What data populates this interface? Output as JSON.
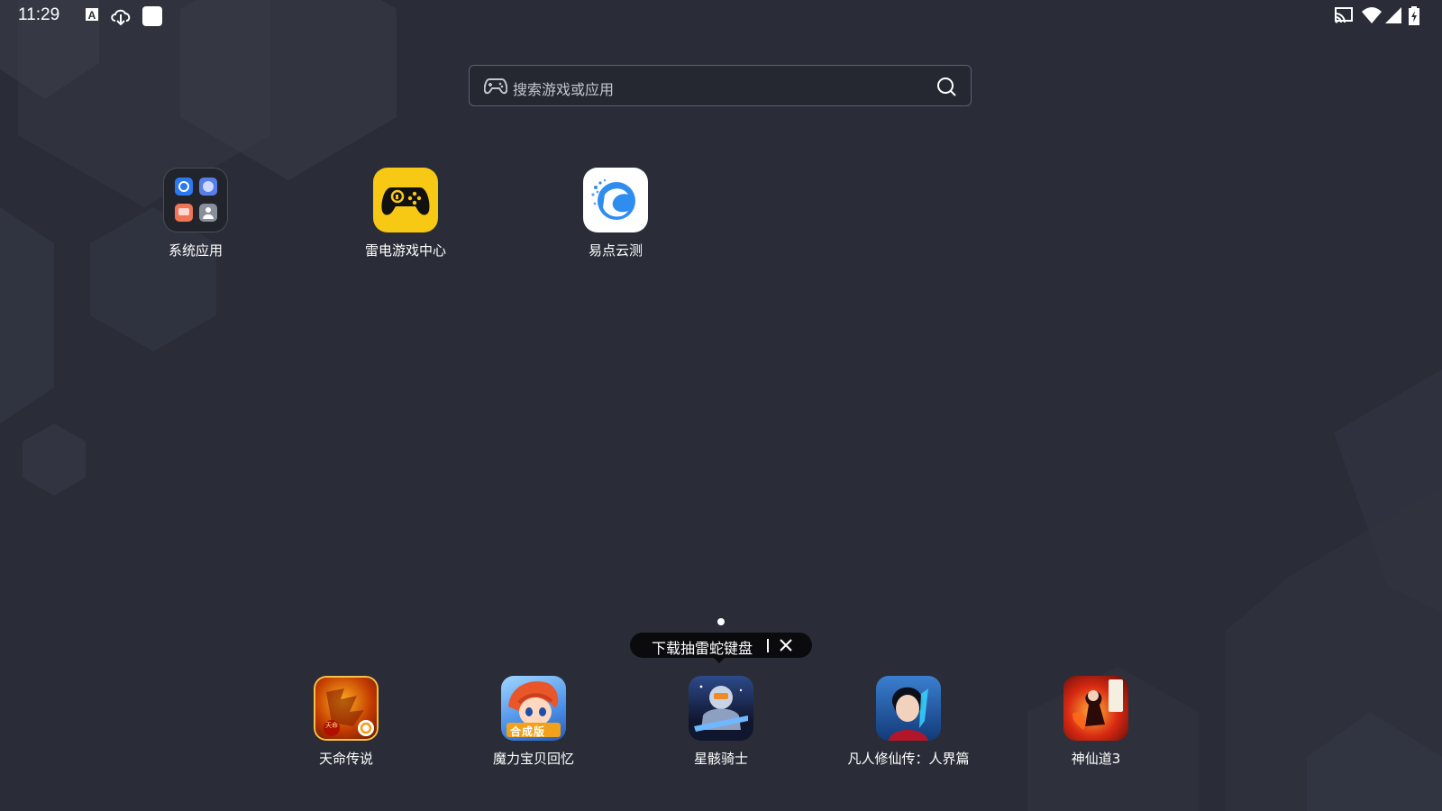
{
  "status_bar": {
    "time": "11:29",
    "left_icons": [
      "text-a-icon",
      "cloud-download-icon",
      "white-square-icon"
    ],
    "right_icons": [
      "cast-icon",
      "wifi-icon",
      "cell-signal-icon",
      "battery-charging-icon"
    ]
  },
  "search": {
    "placeholder": "搜索游戏或应用",
    "left_icon": "gamepad-icon",
    "right_icon": "search-icon"
  },
  "desktop_apps": [
    {
      "label": "系统应用",
      "icon": "folder-system-apps-icon"
    },
    {
      "label": "雷电游戏中心",
      "icon": "game-center-icon",
      "color": "#f7c814"
    },
    {
      "label": "易点云测",
      "icon": "yidian-yunce-icon",
      "color": "#2f8df0"
    }
  ],
  "tooltip": {
    "text": "下载抽雷蛇键盘",
    "close_icon": "close-icon"
  },
  "dock_apps": [
    {
      "label": "天命传说",
      "icon": "tianming-game-icon",
      "badge": "天命"
    },
    {
      "label": "魔力宝贝回忆",
      "icon": "moli-baobei-game-icon",
      "badge": "合成版"
    },
    {
      "label": "星骸骑士",
      "icon": "xinghai-knight-game-icon"
    },
    {
      "label": "凡人修仙传：人界篇",
      "icon": "fanren-xiuxian-game-icon"
    },
    {
      "label": "神仙道3",
      "icon": "shenxiandao-game-icon"
    }
  ],
  "colors": {
    "background": "#2a2d37",
    "accent_yellow": "#f7c814",
    "accent_blue": "#2f8df0"
  }
}
